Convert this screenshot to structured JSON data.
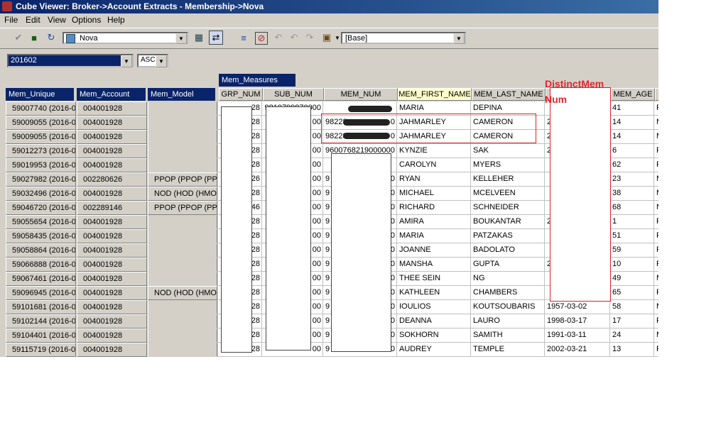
{
  "window": {
    "title": "Cube Viewer: Broker->Account Extracts - Membership->Nova"
  },
  "menu": [
    "File",
    "Edit",
    "View",
    "Options",
    "Help"
  ],
  "toolbar": {
    "cube_combo": "Nova",
    "view_combo": "[Base]",
    "icons": [
      "check-icon",
      "save-icon",
      "refresh-icon",
      "cube-icon",
      "calc-icon",
      "suppress-icon",
      "export-icon",
      "stop-icon",
      "undo-icon",
      "undo-disabled-icon",
      "redo-disabled-icon",
      "chart-icon"
    ]
  },
  "filters": {
    "period": "201602",
    "sort": "ASC"
  },
  "grid": {
    "measures_header": "Mem_Measures",
    "row_headers": [
      "Mem_Unique",
      "Mem_Account",
      "Mem_Model"
    ],
    "columns": [
      "GRP_NUM",
      "SUB_NUM",
      "MEM_NUM",
      "MEM_FIRST_NAME",
      "MEM_LAST_NAME",
      "",
      "MEM_AGE",
      ""
    ],
    "rows": [
      {
        "unique": "59007740 (2016-0",
        "account": "004001928",
        "model": "",
        "grp": "28",
        "sub": "9819799870000",
        "num": "",
        "first": "MARIA",
        "last": "DEPINA",
        "dob": "",
        "age": "41",
        "g": "F"
      },
      {
        "unique": "59009055 (2016-0",
        "account": "004001928",
        "model": "",
        "grp": "28",
        "sub": "00",
        "num": "98228",
        "num_end": "0",
        "first": "JAHMARLEY",
        "last": "CAMERON",
        "dob": "2",
        "age": "14",
        "g": "M"
      },
      {
        "unique": "59009055 (2016-0",
        "account": "004001928",
        "model": "",
        "grp": "28",
        "sub": "00",
        "num": "98228",
        "num_end": "0",
        "first": "JAHMARLEY",
        "last": "CAMERON",
        "dob": "2",
        "age": "14",
        "g": "M"
      },
      {
        "unique": "59012273 (2016-0",
        "account": "004001928",
        "model": "",
        "grp": "28",
        "sub": "00",
        "num": "9600768219000000",
        "first": "KYNZIE",
        "last": "SAK",
        "dob": "2",
        "age": "6",
        "g": "F"
      },
      {
        "unique": "59019953 (2016-0",
        "account": "004001928",
        "model": "",
        "grp": "28",
        "sub": "00",
        "num": "",
        "first": "CAROLYN",
        "last": "MYERS",
        "dob": "",
        "age": "62",
        "g": "F"
      },
      {
        "unique": "59027982 (2016-0",
        "account": "002280626",
        "model": "PPOP (PPOP (PPO",
        "grp": "26",
        "sub": "00",
        "num": "9",
        "num_end": "0",
        "first": "RYAN",
        "last": "KELLEHER",
        "dob": "",
        "age": "23",
        "g": "M"
      },
      {
        "unique": "59032496 (2016-0",
        "account": "004001928",
        "model": "NOD (HOD (HMOB",
        "grp": "28",
        "sub": "00",
        "num": "9",
        "num_end": "0",
        "first": "MICHAEL",
        "last": "MCELVEEN",
        "dob": "",
        "age": "38",
        "g": "M"
      },
      {
        "unique": "59046720 (2016-0",
        "account": "002289146",
        "model": "PPOP (PPOP (PPO",
        "grp": "46",
        "sub": "00",
        "num": "9",
        "num_end": "0",
        "first": "RICHARD",
        "last": "SCHNEIDER",
        "dob": "",
        "age": "68",
        "g": "M"
      },
      {
        "unique": "59055654 (2016-0",
        "account": "004001928",
        "model": "",
        "grp": "28",
        "sub": "00",
        "num": "9",
        "num_end": "0",
        "first": "AMIRA",
        "last": "BOUKANTAR",
        "dob": "2",
        "age": "1",
        "g": "F"
      },
      {
        "unique": "59058435 (2016-0",
        "account": "004001928",
        "model": "",
        "grp": "28",
        "sub": "00",
        "num": "9",
        "num_end": "0",
        "first": "MARIA",
        "last": "PATZAKAS",
        "dob": "",
        "age": "51",
        "g": "F"
      },
      {
        "unique": "59058864 (2016-0",
        "account": "004001928",
        "model": "",
        "grp": "28",
        "sub": "00",
        "num": "9",
        "num_end": "0",
        "first": "JOANNE",
        "last": "BADOLATO",
        "dob": "",
        "age": "59",
        "g": "F"
      },
      {
        "unique": "59066888 (2016-0",
        "account": "004001928",
        "model": "",
        "grp": "28",
        "sub": "00",
        "num": "9",
        "num_end": "0",
        "first": "MANSHA",
        "last": "GUPTA",
        "dob": "2",
        "age": "10",
        "g": "F"
      },
      {
        "unique": "59067461 (2016-0",
        "account": "004001928",
        "model": "",
        "grp": "28",
        "sub": "00",
        "num": "9",
        "num_end": "0",
        "first": "THEE SEIN",
        "last": "NG",
        "dob": "",
        "age": "49",
        "g": "M"
      },
      {
        "unique": "59096945 (2016-0",
        "account": "004001928",
        "model": "NOD (HOD (HMOB",
        "grp": "28",
        "sub": "00",
        "num": "9",
        "num_end": "0",
        "first": "KATHLEEN",
        "last": "CHAMBERS",
        "dob": "",
        "age": "65",
        "g": "F"
      },
      {
        "unique": "59101681 (2016-0",
        "account": "004001928",
        "model": "",
        "grp": "28",
        "sub": "00",
        "num": "9",
        "num_end": "0",
        "first": "IOULIOS",
        "last": "KOUTSOUBARIS",
        "dob": "1957-03-02",
        "age": "58",
        "g": "M"
      },
      {
        "unique": "59102144 (2016-0",
        "account": "004001928",
        "model": "",
        "grp": "28",
        "sub": "00",
        "num": "9",
        "num_end": "0",
        "first": "DEANNA",
        "last": "LAURO",
        "dob": "1998-03-17",
        "age": "17",
        "g": "F"
      },
      {
        "unique": "59104401 (2016-0",
        "account": "004001928",
        "model": "",
        "grp": "28",
        "sub": "00",
        "num": "9",
        "num_end": "0",
        "first": "SOKHORN",
        "last": "SAMITH",
        "dob": "1991-03-11",
        "age": "24",
        "g": "M"
      },
      {
        "unique": "59115719 (2016-0",
        "account": "004001928",
        "model": "",
        "grp": "28",
        "sub": "00",
        "num": "9",
        "num_end": "0",
        "first": "AUDREY",
        "last": "TEMPLE",
        "dob": "2002-03-21",
        "age": "13",
        "g": "F"
      }
    ]
  },
  "annotation": {
    "line1": "DistinctMem",
    "line2": "Num"
  },
  "colors": {
    "title_bar": "#0a246a",
    "header_dim": "#0a246a",
    "annotation": "#e0282e",
    "selected_header": "#ffffcc"
  }
}
